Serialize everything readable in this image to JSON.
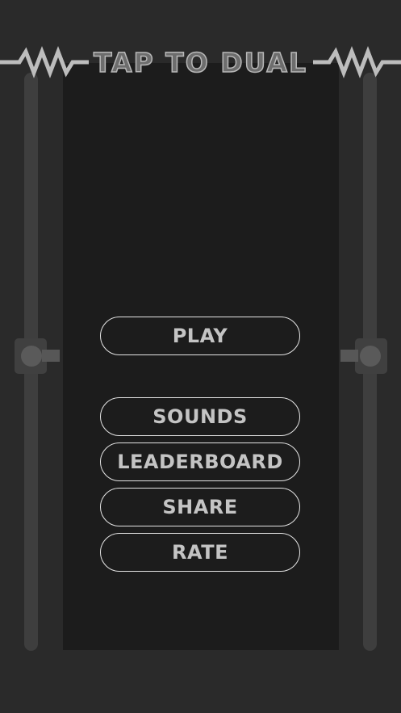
{
  "game": {
    "title": "TAP TO DUAL"
  },
  "menu": {
    "play_label": "PLAY",
    "sounds_label": "SOUNDS",
    "leaderboard_label": "LEADERBOARD",
    "share_label": "SHARE",
    "rate_label": "RATE"
  },
  "colors": {
    "background": "#2a2a2a",
    "panel": "#1c1c1c",
    "rail": "#3e3e3e",
    "button_border": "#e4e4e4",
    "button_text": "#c4c4c4",
    "title_fill": "#6d6d6d",
    "title_outline": "#b8b8b8"
  }
}
